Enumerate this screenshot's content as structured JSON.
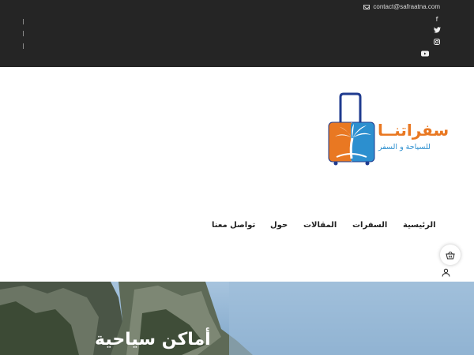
{
  "topbar": {
    "contact_email": "contact@safraatna.com",
    "icons": [
      "mail-icon",
      "facebook-icon",
      "twitter-icon",
      "instagram-icon",
      "youtube-icon"
    ],
    "social_glyphs": {
      "facebook": "f",
      "twitter": "🐦",
      "instagram": "◎",
      "youtube": "▶"
    }
  },
  "logo": {
    "name": "سفراتنــا",
    "tagline": "للسياحة و السفر",
    "colors": {
      "orange": "#e97822",
      "blue": "#2c8fcf",
      "navy": "#1f3b8f"
    }
  },
  "nav": {
    "items": [
      "الرئيسية",
      "السفرات",
      "المقالات",
      "حول",
      "تواصل معنا"
    ]
  },
  "hero": {
    "heading": "أماكن سياحية"
  },
  "colors": {
    "topbar_bg": "#252525",
    "sky": "#8fb7d8"
  }
}
